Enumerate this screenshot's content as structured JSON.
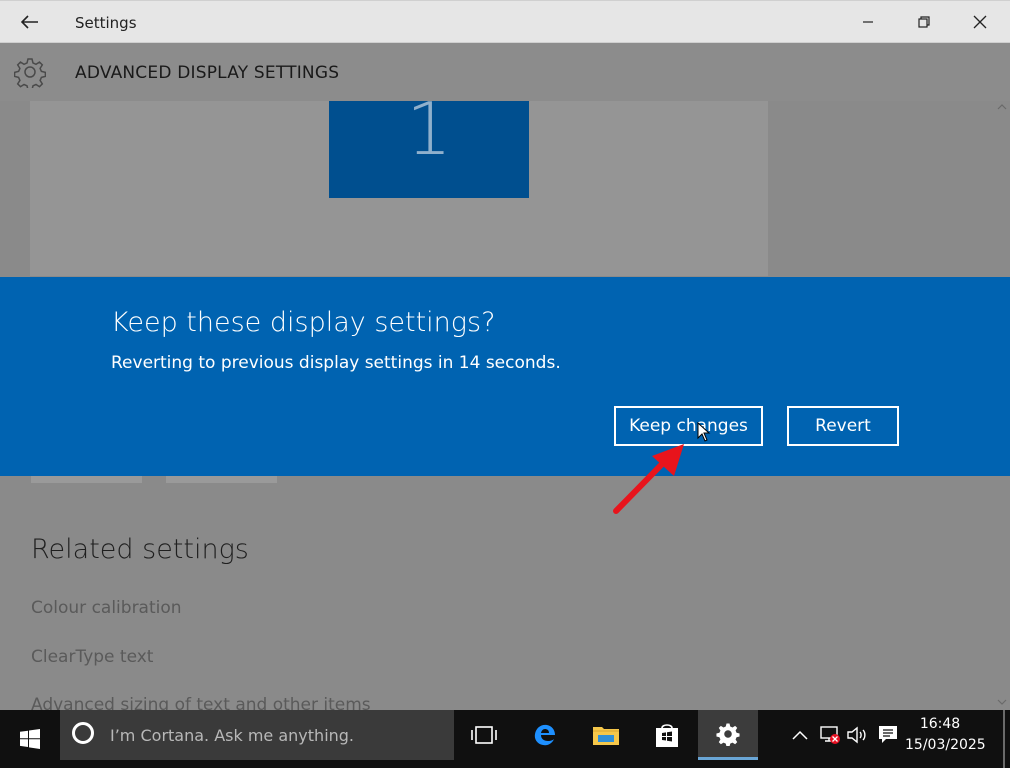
{
  "window": {
    "title": "Settings",
    "back_label": "←"
  },
  "header": {
    "title": "ADVANCED DISPLAY SETTINGS"
  },
  "preview": {
    "monitor_number": "1"
  },
  "dialog": {
    "title": "Keep these display settings?",
    "message": "Reverting to previous display settings in 14 seconds.",
    "keep_label": "Keep changes",
    "revert_label": "Revert"
  },
  "related": {
    "heading": "Related settings",
    "links": [
      "Colour calibration",
      "ClearType text",
      "Advanced sizing of text and other items"
    ]
  },
  "taskbar": {
    "search_placeholder": "I’m Cortana. Ask me anything.",
    "time": "16:48",
    "date": "15/03/2025"
  },
  "colors": {
    "accent": "#0063b1",
    "arrow": "#e8141c"
  }
}
